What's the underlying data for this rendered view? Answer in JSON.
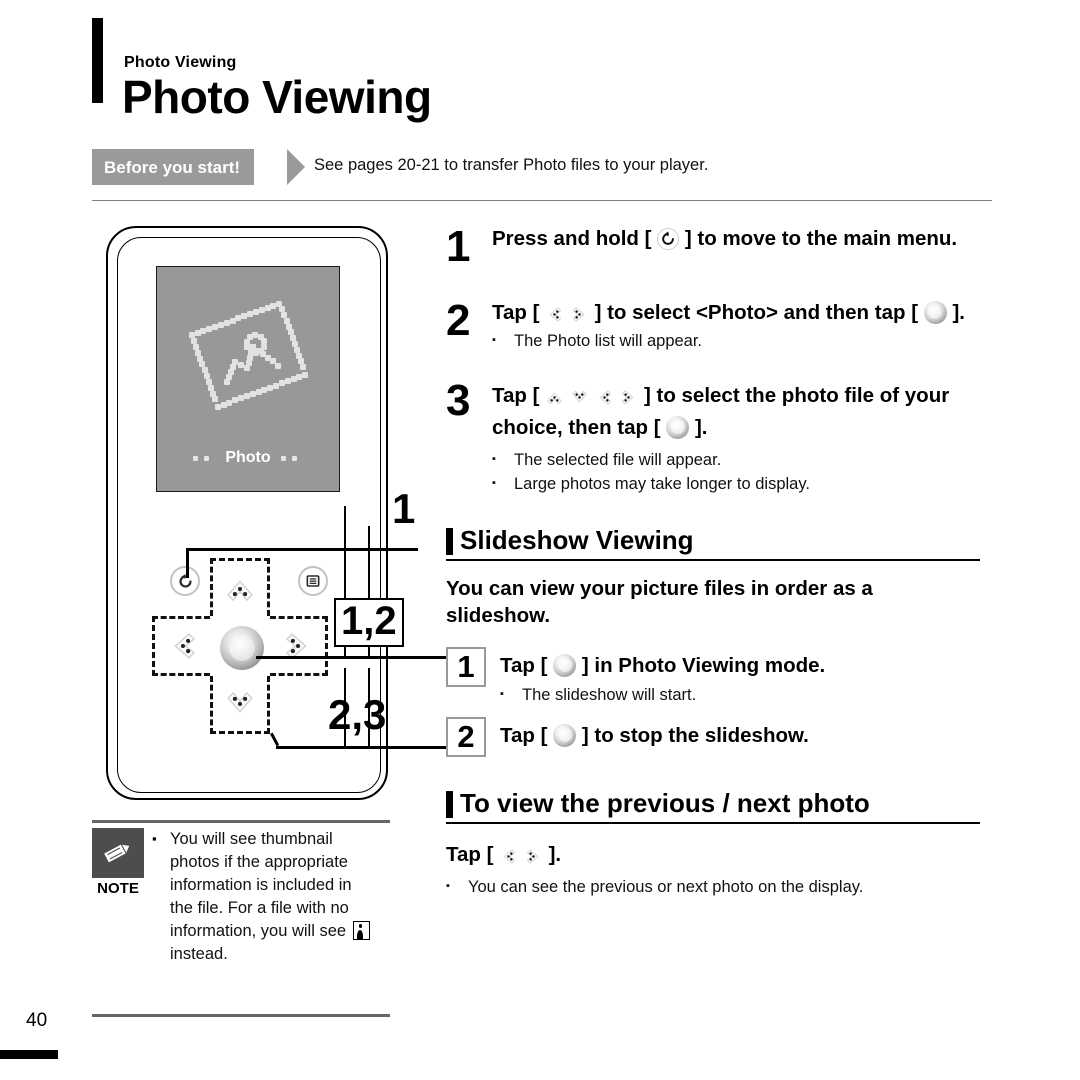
{
  "header": {
    "kicker": "Photo Viewing",
    "title": "Photo Viewing"
  },
  "before_you_start": {
    "tag": "Before you start!",
    "text": "See pages 20-21 to transfer Photo files to your player."
  },
  "device": {
    "screen_label": "Photo",
    "icons": {
      "return_button": "return-icon",
      "menu_button": "menu-icon",
      "up_pad": "up-chevron-icon",
      "down_pad": "down-chevron-icon",
      "left_pad": "left-chevron-icon",
      "right_pad": "right-chevron-icon",
      "select_button": "select-round-icon"
    },
    "callouts": {
      "return": "1",
      "select": "1,2",
      "pad": "2,3"
    }
  },
  "note": {
    "label": "NOTE",
    "icon": "pencil-icon",
    "bullet": "▪",
    "line1": "You will see thumbnail photos if the appropriate information is included in the file.",
    "line2_a": "For a file with no information, you will see",
    "line2_b": "instead."
  },
  "page": {
    "number": "40"
  },
  "steps": [
    {
      "num": "1",
      "title_a": "Press and hold [",
      "icon": "return-icon",
      "title_b": "] to move to the main menu.",
      "bullets": []
    },
    {
      "num": "2",
      "title_a": "Tap [",
      "icon": "left-right-chevron-icon",
      "title_b": "] to select <Photo> and then tap [",
      "icon2": "select-round-icon",
      "title_c": "].",
      "bullets": [
        "The Photo list will appear."
      ]
    },
    {
      "num": "3",
      "title_a": "Tap [",
      "icon": "four-way-chevron-icon",
      "title_b": "] to select the photo file of your choice, then tap [",
      "icon2": "select-round-icon",
      "title_c": "].",
      "bullets": [
        "The selected file will appear.",
        "Large photos may take longer to display."
      ]
    }
  ],
  "slideshow_section": {
    "heading": "Slideshow Viewing",
    "lead": "You can view your picture files in order as a slideshow.",
    "steps": [
      {
        "num": "1",
        "title_a": "Tap [",
        "icon": "select-round-icon",
        "title_b": "] in Photo Viewing mode.",
        "bullets": [
          "The slideshow will start."
        ]
      },
      {
        "num": "2",
        "title_a": "Tap [",
        "icon": "select-round-icon",
        "title_b": "] to stop the slideshow.",
        "bullets": []
      }
    ]
  },
  "prevnext_section": {
    "heading": "To view the previous / next photo",
    "instruction_a": "Tap [",
    "icon": "left-right-chevron-icon",
    "instruction_b": "].",
    "bullets": [
      "You can see the previous or next photo on the display."
    ]
  },
  "bullet_mark": "▪",
  "colors": {
    "banner_gray": "#9a9a9a",
    "screen_gray": "#989898",
    "note_icon_gray": "#4d4d4d",
    "rule_gray": "#808080"
  }
}
